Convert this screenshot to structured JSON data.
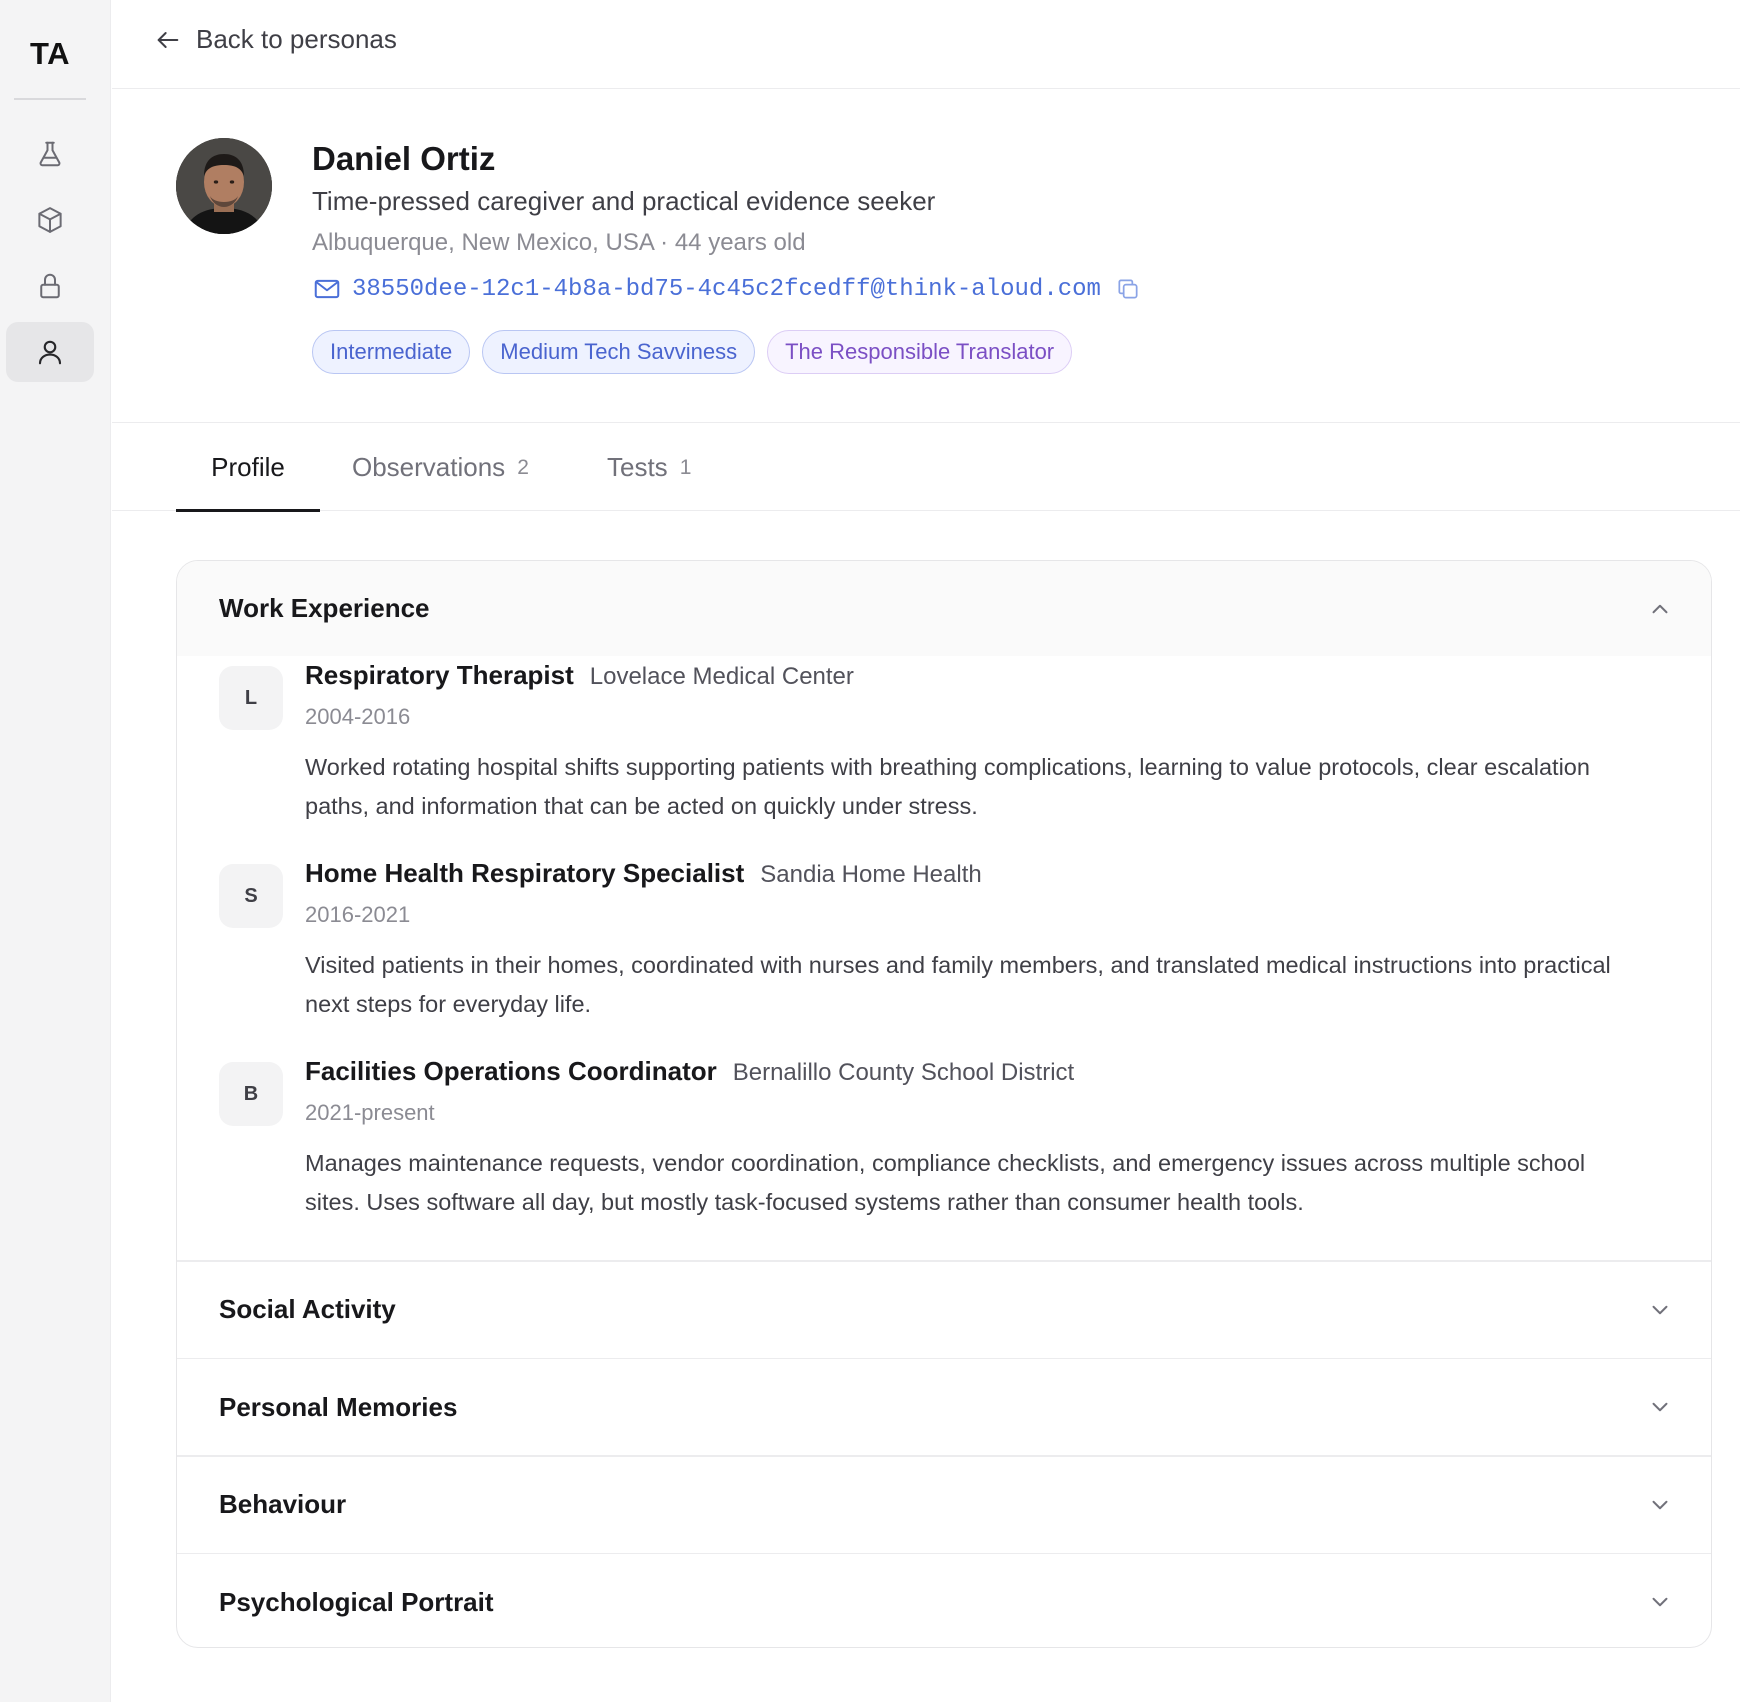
{
  "sidebar": {
    "logo": "TA",
    "items": [
      {
        "name": "flask-icon",
        "active": false
      },
      {
        "name": "cube-icon",
        "active": false
      },
      {
        "name": "lock-icon",
        "active": false
      },
      {
        "name": "user-icon",
        "active": true
      }
    ]
  },
  "topbar": {
    "back_label": "Back to personas"
  },
  "persona": {
    "name": "Daniel Ortiz",
    "subtitle": "Time-pressed caregiver and practical evidence seeker",
    "meta": "Albuquerque, New Mexico, USA · 44 years old",
    "email": "38550dee-12c1-4b8a-bd75-4c45c2fcedff@think-aloud.com",
    "tags": [
      "Intermediate",
      "Medium Tech Savviness",
      "The Responsible Translator"
    ]
  },
  "tabs": [
    {
      "label": "Profile",
      "count": "",
      "active": true
    },
    {
      "label": "Observations",
      "count": "2",
      "active": false
    },
    {
      "label": "Tests",
      "count": "1",
      "active": false
    }
  ],
  "sections": {
    "work_experience": {
      "title": "Work Experience",
      "expanded": true,
      "jobs": [
        {
          "initial": "L",
          "role": "Respiratory Therapist",
          "company": "Lovelace Medical Center",
          "years": "2004-2016",
          "description": "Worked rotating hospital shifts supporting patients with breathing complications, learning to value protocols, clear escalation paths, and information that can be acted on quickly under stress."
        },
        {
          "initial": "S",
          "role": "Home Health Respiratory Specialist",
          "company": "Sandia Home Health",
          "years": "2016-2021",
          "description": "Visited patients in their homes, coordinated with nurses and family members, and translated medical instructions into practical next steps for everyday life."
        },
        {
          "initial": "B",
          "role": "Facilities Operations Coordinator",
          "company": "Bernalillo County School District",
          "years": "2021-present",
          "description": "Manages maintenance requests, vendor coordination, compliance checklists, and emergency issues across multiple school sites. Uses software all day, but mostly task-focused systems rather than consumer health tools."
        }
      ]
    },
    "social_activity": {
      "title": "Social Activity",
      "expanded": false
    },
    "personal_memories": {
      "title": "Personal Memories",
      "expanded": false
    },
    "behaviour": {
      "title": "Behaviour",
      "expanded": false
    },
    "psychological_portrait": {
      "title": "Psychological Portrait",
      "expanded": false
    }
  },
  "colors": {
    "accent_blue": "#4a6fd8",
    "tag_purple": "#7b4fc4",
    "sidebar_bg": "#f4f4f5"
  }
}
